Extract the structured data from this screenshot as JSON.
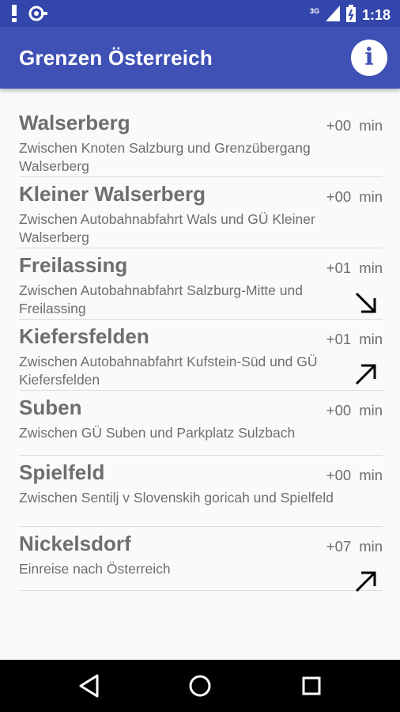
{
  "status_bar": {
    "network_label": "3G",
    "time": "1:18",
    "icons": [
      "alert-icon",
      "notification-icon",
      "signal-icon",
      "battery-icon"
    ]
  },
  "app_bar": {
    "title": "Grenzen Österreich",
    "info_icon": "info-icon",
    "info_glyph": "i"
  },
  "items": [
    {
      "name": "Walserberg",
      "description": "Zwischen Knoten Salzburg und Grenzübergang Walserberg",
      "delay": "+00",
      "unit": "min",
      "trend": ""
    },
    {
      "name": "Kleiner Walserberg",
      "description": "Zwischen Autobahnabfahrt Wals und GÜ Kleiner Walserberg",
      "delay": "+00",
      "unit": "min",
      "trend": ""
    },
    {
      "name": "Freilassing",
      "description": "Zwischen Autobahnabfahrt Salzburg-Mitte und Freilassing",
      "delay": "+01",
      "unit": "min",
      "trend": "arrow-down-right-icon"
    },
    {
      "name": "Kiefersfelden",
      "description": "Zwischen Autobahnabfahrt Kufstein-Süd und GÜ Kiefersfelden",
      "delay": "+01",
      "unit": "min",
      "trend": "arrow-up-right-icon"
    },
    {
      "name": "Suben",
      "description": "Zwischen GÜ Suben und Parkplatz Sulzbach",
      "delay": "+00",
      "unit": "min",
      "trend": ""
    },
    {
      "name": "Spielfeld",
      "description": "Zwischen Sentilj v Slovenskih goricah und Spielfeld",
      "delay": "+00",
      "unit": "min",
      "trend": ""
    },
    {
      "name": "Nickelsdorf",
      "description": "Einreise nach Österreich",
      "delay": "+07",
      "unit": "min",
      "trend": "arrow-up-right-icon"
    }
  ],
  "nav_bar": {
    "buttons": [
      "back-icon",
      "home-icon",
      "recents-icon"
    ]
  },
  "colors": {
    "primary": "#3f51b5",
    "primary_dark": "#3346ab",
    "text": "#6e6e6e",
    "divider": "#dcdcdc"
  }
}
